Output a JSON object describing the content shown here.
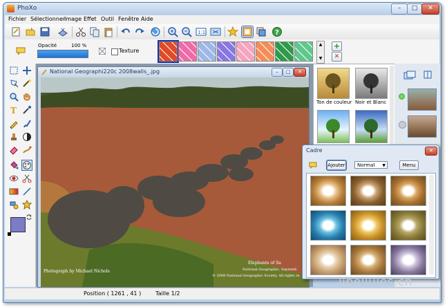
{
  "window": {
    "title": "PhoXo",
    "minimize": "–",
    "maximize": "□",
    "close": "✕"
  },
  "menu": [
    "Fichier",
    "Sélectionner",
    "Image",
    "Effet",
    "Outil",
    "Fenêtre",
    "Aide"
  ],
  "options": {
    "opacity_label": "Opacité",
    "opacity_value": "100 %",
    "opacity_level": 1.0,
    "texture_label": "Texture",
    "texture_colors": [
      "#e14a26",
      "#f06aa8",
      "#9db8e6",
      "#8877e0",
      "#f7a4bf",
      "#f78c58",
      "#2f9a4b",
      "#5fc88c"
    ],
    "add_button": "+",
    "delete_button": "✕"
  },
  "document": {
    "title": "National Geographi220c 2008walls_.jpg",
    "credit_left": "Photograph by Michael Nichols",
    "credit_right_1": "Elephants of Sa",
    "credit_right_2": "National Geographic, Septemb",
    "credit_right_3": "© 2008 National Geographic Society. All rights re"
  },
  "effects": [
    {
      "label": "Ton de couleur"
    },
    {
      "label": "Noir et Blanc"
    },
    {
      "label": ""
    },
    {
      "label": ""
    }
  ],
  "cadre": {
    "title": "Cadre",
    "add_button": "Ajouter",
    "mode": "Normal",
    "menu_button": "Menu",
    "close": "✕"
  },
  "status": {
    "position": "Position ( 1261 , 41 )",
    "size": "Taille 1/2"
  },
  "watermark": "libellules.ch"
}
